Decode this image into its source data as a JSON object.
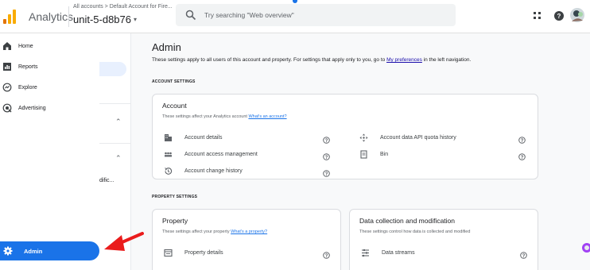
{
  "topbar": {
    "app_name": "Analytics",
    "account_breadcrumb": "All accounts > Default Account for Fire...",
    "property_name": "unit-5-d8b76",
    "search_placeholder": "Try searching \"Web overview\""
  },
  "nav": {
    "items": [
      {
        "label": "Home",
        "icon": "home-icon"
      },
      {
        "label": "Reports",
        "icon": "reports-icon"
      },
      {
        "label": "Explore",
        "icon": "explore-icon"
      },
      {
        "label": "Advertising",
        "icon": "advertising-icon"
      }
    ],
    "admin_label": "Admin"
  },
  "subnav": {
    "truncated_text": "dific..."
  },
  "main": {
    "title": "Admin",
    "description_prefix": "These settings apply to all users of this account and property. For settings that apply only to you, go to",
    "description_link": "My preferences",
    "description_suffix": "in the left navigation.",
    "account_settings_label": "ACCOUNT SETTINGS",
    "property_settings_label": "PROPERTY SETTINGS",
    "account_card": {
      "title": "Account",
      "subtitle": "These settings affect your Analytics account",
      "subtitle_link": "What's an account?",
      "left_rows": [
        "Account details",
        "Account access management",
        "Account change history"
      ],
      "right_rows": [
        "Account data API quota history",
        "Bin"
      ]
    },
    "property_card": {
      "title": "Property",
      "subtitle": "These settings affect your property",
      "subtitle_link": "What's a property?",
      "rows": [
        "Property details"
      ]
    },
    "data_card": {
      "title": "Data collection and modification",
      "subtitle": "These settings control how data is collected and modified",
      "rows": [
        "Data streams"
      ]
    }
  },
  "colors": {
    "accent": "#1a73e8",
    "annotation_arrow": "#ea1c1c",
    "logo_orange": "#e37400",
    "logo_yellow": "#f9ab00"
  }
}
